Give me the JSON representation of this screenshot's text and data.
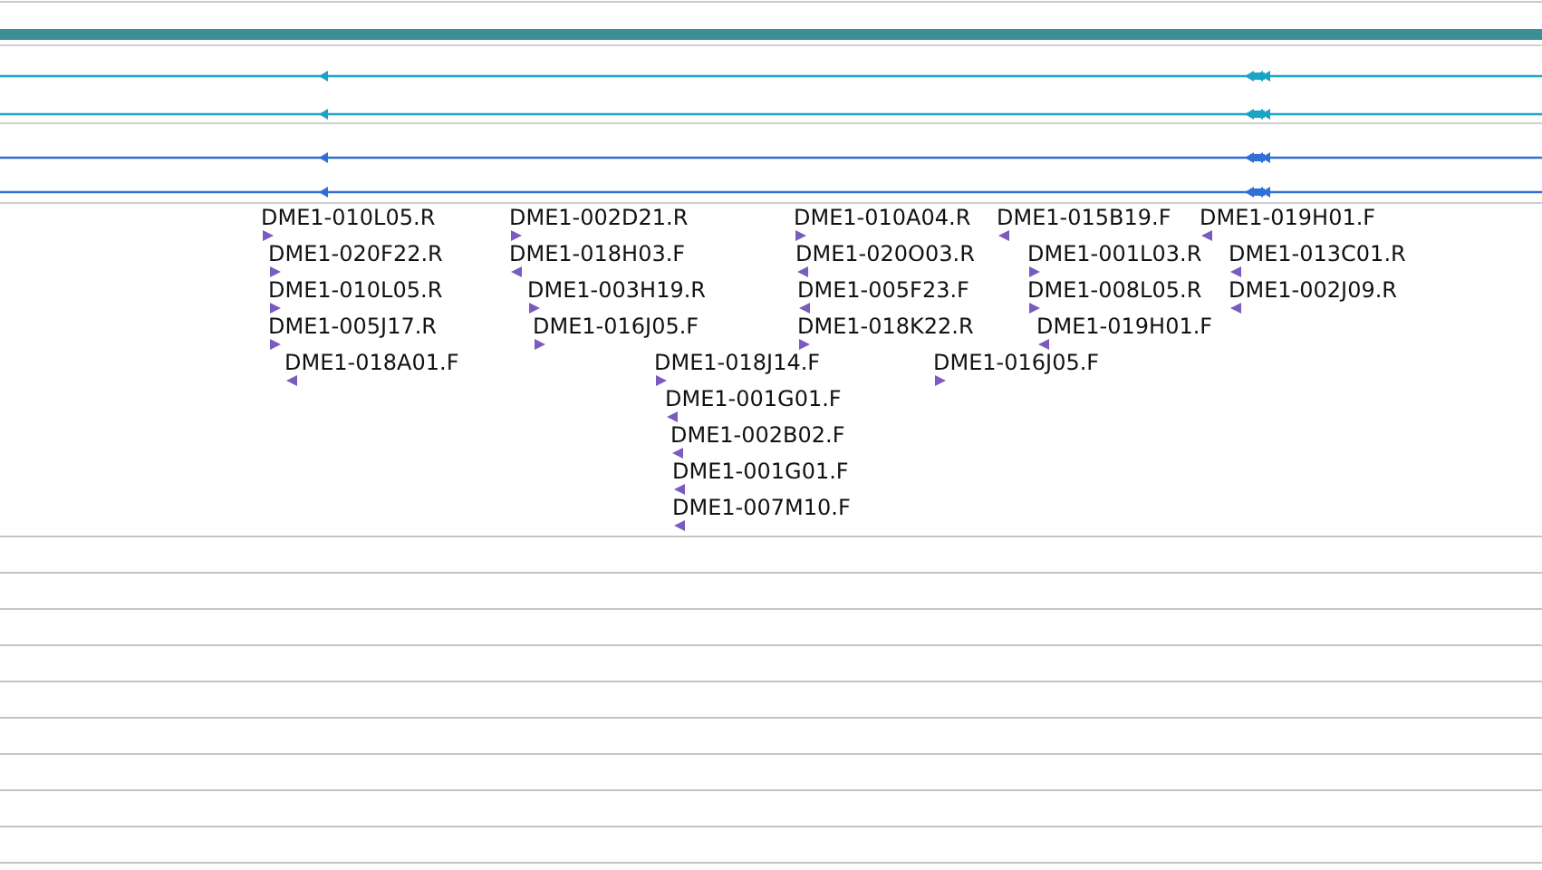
{
  "tracks": [
    {
      "color": "#1aa3c4"
    },
    {
      "color": "#1aa3c4"
    },
    {
      "color": "#2f6fd6"
    },
    {
      "color": "#2f6fd6"
    }
  ],
  "reads": [
    {
      "label": "DME1-010L05.R",
      "reverse": false
    },
    {
      "label": "DME1-020F22.R",
      "reverse": false
    },
    {
      "label": "DME1-010L05.R",
      "reverse": false
    },
    {
      "label": "DME1-005J17.R",
      "reverse": false
    },
    {
      "label": "DME1-018A01.F",
      "reverse": true
    },
    {
      "label": "DME1-002D21.R",
      "reverse": false
    },
    {
      "label": "DME1-018H03.F",
      "reverse": true
    },
    {
      "label": "DME1-003H19.R",
      "reverse": false
    },
    {
      "label": "DME1-016J05.F",
      "reverse": false
    },
    {
      "label": "DME1-018J14.F",
      "reverse": false
    },
    {
      "label": "DME1-001G01.F",
      "reverse": true
    },
    {
      "label": "DME1-002B02.F",
      "reverse": true
    },
    {
      "label": "DME1-001G01.F",
      "reverse": true
    },
    {
      "label": "DME1-007M10.F",
      "reverse": true
    },
    {
      "label": "DME1-010A04.R",
      "reverse": false
    },
    {
      "label": "DME1-020O03.R",
      "reverse": true
    },
    {
      "label": "DME1-005F23.F",
      "reverse": true
    },
    {
      "label": "DME1-018K22.R",
      "reverse": false
    },
    {
      "label": "DME1-016J05.F",
      "reverse": false
    },
    {
      "label": "DME1-015B19.F",
      "reverse": true
    },
    {
      "label": "DME1-001L03.R",
      "reverse": false
    },
    {
      "label": "DME1-008L05.R",
      "reverse": false
    },
    {
      "label": "DME1-019H01.F",
      "reverse": true
    },
    {
      "label": "DME1-019H01.F",
      "reverse": true
    },
    {
      "label": "DME1-013C01.R",
      "reverse": true
    },
    {
      "label": "DME1-002J09.R",
      "reverse": true
    }
  ]
}
